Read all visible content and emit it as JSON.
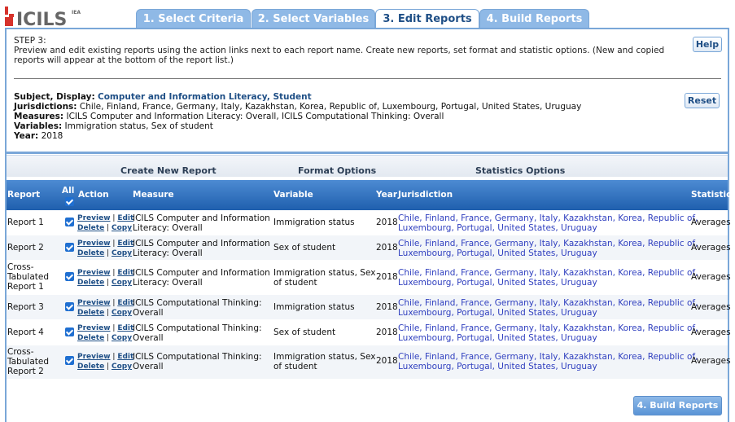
{
  "logo": {
    "text": "ICILS",
    "suffix": "IEA"
  },
  "tabs": [
    {
      "label": "1. Select Criteria"
    },
    {
      "label": "2. Select Variables"
    },
    {
      "label": "3. Edit Reports"
    },
    {
      "label": "4. Build Reports"
    }
  ],
  "step": {
    "title": "STEP 3:",
    "description": "Preview and edit existing reports using the action links next to each report name. Create new reports, set format and statistic options. (New and copied reports will appear at the bottom of the report list.)"
  },
  "buttons": {
    "help": "Help",
    "reset": "Reset",
    "build": "4. Build Reports"
  },
  "summary": {
    "subject_label": "Subject, Display:",
    "subject_value": "Computer and Information Literacy, Student",
    "jurisdictions_label": "Jurisdictions:",
    "jurisdictions_value": "Chile, Finland, France, Germany, Italy, Kazakhstan, Korea, Republic of, Luxembourg, Portugal, United States, Uruguay",
    "measures_label": "Measures:",
    "measures_value": "ICILS Computer and Information Literacy: Overall, ICILS Computational Thinking: Overall",
    "variables_label": "Variables:",
    "variables_value": "Immigration status, Sex of student",
    "year_label": "Year:",
    "year_value": "2018"
  },
  "options": {
    "create": "Create New Report",
    "format": "Format Options",
    "statistics": "Statistics Options"
  },
  "columns": {
    "report": "Report",
    "all": "All",
    "action": "Action",
    "measure": "Measure",
    "variable": "Variable",
    "year": "Year",
    "jurisdiction": "Jurisdiction",
    "statistic": "Statistic"
  },
  "actions": {
    "preview": "Preview",
    "edit": "Edit",
    "delete": "Delete",
    "copy": "Copy",
    "sep": "|"
  },
  "rows": [
    {
      "report": [
        "Report 1"
      ],
      "measure": [
        "ICILS Computer and Information",
        "Literacy: Overall"
      ],
      "variable": [
        "Immigration status"
      ],
      "year": "2018",
      "jurisdiction": [
        "Chile, Finland, France, Germany, Italy, Kazakhstan, Korea, Republic of,",
        "Luxembourg, Portugal, United States, Uruguay"
      ],
      "statistic": "Averages"
    },
    {
      "report": [
        "Report 2"
      ],
      "measure": [
        "ICILS Computer and Information",
        "Literacy: Overall"
      ],
      "variable": [
        "Sex of student"
      ],
      "year": "2018",
      "jurisdiction": [
        "Chile, Finland, France, Germany, Italy, Kazakhstan, Korea, Republic of,",
        "Luxembourg, Portugal, United States, Uruguay"
      ],
      "statistic": "Averages"
    },
    {
      "report": [
        "Cross-",
        "Tabulated",
        "Report 1"
      ],
      "measure": [
        "ICILS Computer and Information",
        "Literacy: Overall"
      ],
      "variable": [
        "Immigration status, Sex",
        "of student"
      ],
      "year": "2018",
      "jurisdiction": [
        "Chile, Finland, France, Germany, Italy, Kazakhstan, Korea, Republic of,",
        "Luxembourg, Portugal, United States, Uruguay"
      ],
      "statistic": "Averages"
    },
    {
      "report": [
        "Report 3"
      ],
      "measure": [
        "ICILS Computational Thinking:",
        "Overall"
      ],
      "variable": [
        "Immigration status"
      ],
      "year": "2018",
      "jurisdiction": [
        "Chile, Finland, France, Germany, Italy, Kazakhstan, Korea, Republic of,",
        "Luxembourg, Portugal, United States, Uruguay"
      ],
      "statistic": "Averages"
    },
    {
      "report": [
        "Report 4"
      ],
      "measure": [
        "ICILS Computational Thinking:",
        "Overall"
      ],
      "variable": [
        "Sex of student"
      ],
      "year": "2018",
      "jurisdiction": [
        "Chile, Finland, France, Germany, Italy, Kazakhstan, Korea, Republic of,",
        "Luxembourg, Portugal, United States, Uruguay"
      ],
      "statistic": "Averages"
    },
    {
      "report": [
        "Cross-",
        "Tabulated",
        "Report 2"
      ],
      "measure": [
        "ICILS Computational Thinking:",
        "Overall"
      ],
      "variable": [
        "Immigration status, Sex",
        "of student"
      ],
      "year": "2018",
      "jurisdiction": [
        "Chile, Finland, France, Germany, Italy, Kazakhstan, Korea, Republic of,",
        "Luxembourg, Portugal, United States, Uruguay"
      ],
      "statistic": "Averages"
    }
  ]
}
